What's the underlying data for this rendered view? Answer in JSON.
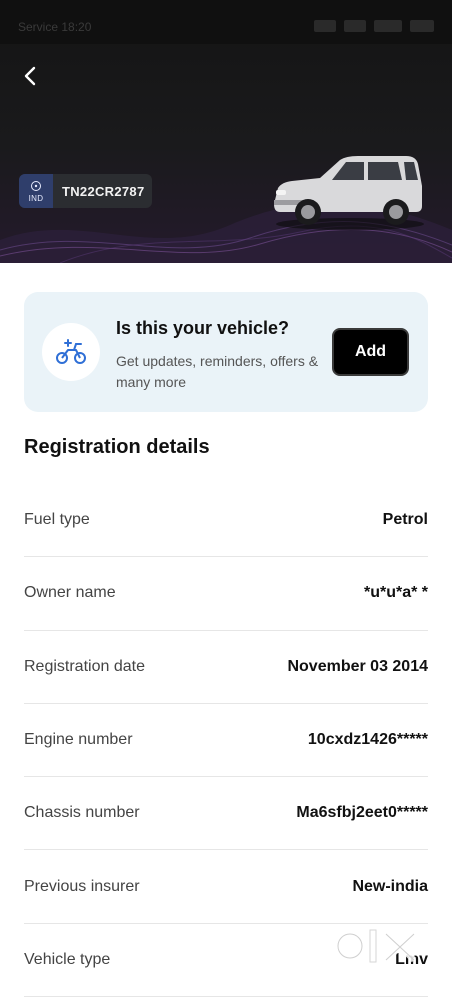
{
  "status_bar": {
    "text": "Service 18:20"
  },
  "vehicle": {
    "country_code": "IND",
    "plate_number": "TN22CR2787"
  },
  "promo_card": {
    "title": "Is this your vehicle?",
    "subtitle": "Get updates, reminders, offers & many more",
    "add_label": "Add"
  },
  "section": {
    "title": "Registration details"
  },
  "details": [
    {
      "label": "Fuel type",
      "value": "Petrol"
    },
    {
      "label": "Owner name",
      "value": "*u*u*a* *"
    },
    {
      "label": "Registration date",
      "value": "November 03 2014"
    },
    {
      "label": "Engine number",
      "value": "10cxdz1426*****"
    },
    {
      "label": "Chassis number",
      "value": "Ma6sfbj2eet0*****"
    },
    {
      "label": "Previous insurer",
      "value": "New-india"
    },
    {
      "label": "Vehicle type",
      "value": "Lmv"
    }
  ],
  "watermark": {
    "text": "olx"
  },
  "colors": {
    "hero_bg": "#141414",
    "card_bg": "#eaf3f8",
    "accent_blue": "#2f6fd6",
    "button_bg": "#000000"
  }
}
